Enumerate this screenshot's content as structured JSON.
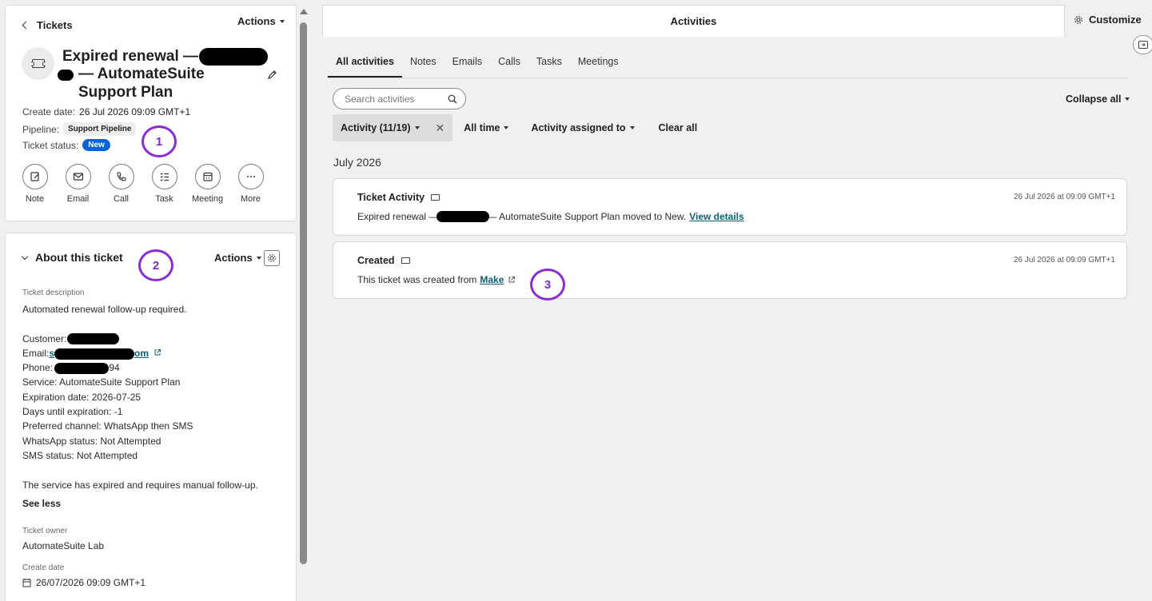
{
  "header": {
    "back_label": "Tickets",
    "actions_label": "Actions"
  },
  "ticket": {
    "title_part1": "Expired renewal —",
    "title_part2": "— AutomateSuite Support Plan",
    "create_date_label": "Create date:",
    "create_date_value": "26 Jul 2026 09:09 GMT+1",
    "pipeline_label": "Pipeline:",
    "pipeline_value": "Support Pipeline",
    "status_label": "Ticket status:",
    "status_value": "New",
    "status_color": "#0a62d6"
  },
  "annotations": {
    "a1": "1",
    "a2": "2",
    "a3": "3",
    "color": "#8a2bd8"
  },
  "quick_actions": [
    {
      "label": "Note",
      "icon": "note-icon"
    },
    {
      "label": "Email",
      "icon": "email-icon"
    },
    {
      "label": "Call",
      "icon": "call-icon"
    },
    {
      "label": "Task",
      "icon": "task-icon"
    },
    {
      "label": "Meeting",
      "icon": "meeting-icon"
    },
    {
      "label": "More",
      "icon": "more-icon"
    }
  ],
  "about": {
    "title": "About this ticket",
    "actions_label": "Actions",
    "description_label": "Ticket description",
    "description_first": "Automated renewal follow-up required.",
    "customer": "Customer:",
    "email_prefix": "Email:",
    "email_link_start": "s",
    "email_link_end": "om",
    "phone_prefix": "Phone: +",
    "phone_suffix": "94",
    "service": "Service: AutomateSuite Support Plan",
    "expiration": "Expiration date: 2026-07-25",
    "days": "Days until expiration: -1",
    "channel": "Preferred channel: WhatsApp then SMS",
    "whatsapp": "WhatsApp status: Not Attempted",
    "sms": "SMS status: Not Attempted",
    "description_last": "The service has expired and requires manual follow-up.",
    "see_less": "See less",
    "owner_label": "Ticket owner",
    "owner_value": "AutomateSuite Lab",
    "create_date_label": "Create date",
    "create_date_value": "26/07/2026 09:09 GMT+1"
  },
  "activities": {
    "panel_title": "Activities",
    "customize_label": "Customize",
    "tabs": [
      "All activities",
      "Notes",
      "Emails",
      "Calls",
      "Tasks",
      "Meetings"
    ],
    "search_placeholder": "Search activities",
    "collapse_all": "Collapse all",
    "filters": {
      "activity": "Activity (11/19)",
      "time": "All time",
      "assigned": "Activity assigned to",
      "clear": "Clear all"
    },
    "month": "July 2026",
    "items": [
      {
        "title": "Ticket Activity",
        "time": "26 Jul 2026 at 09:09 GMT+1",
        "body_start": "Expired renewal —",
        "body_end": "— AutomateSuite Support Plan moved to New.",
        "link": "View details"
      },
      {
        "title": "Created",
        "time": "26 Jul 2026 at 09:09 GMT+1",
        "body_start": "This ticket was created from",
        "link": "Make"
      }
    ]
  }
}
